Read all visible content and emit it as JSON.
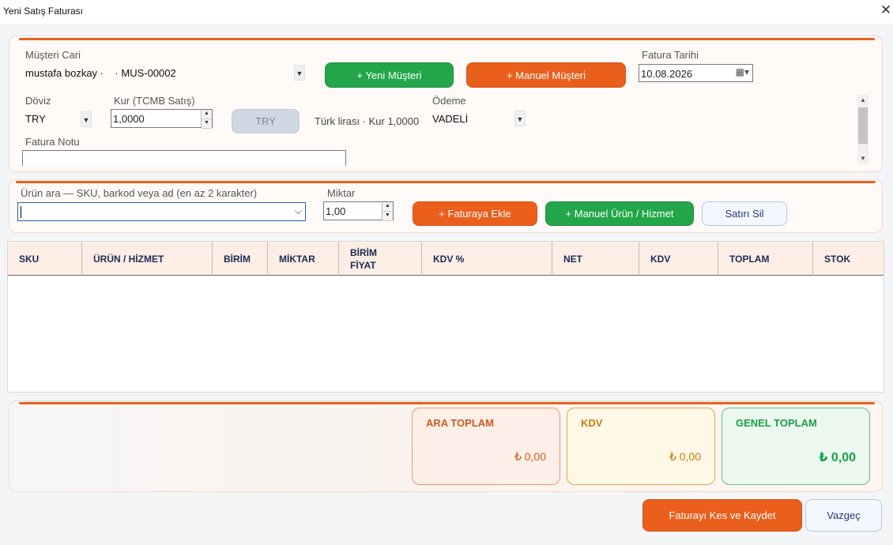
{
  "window": {
    "title": "Yeni Satış Faturası",
    "close_glyph": "✕"
  },
  "customer": {
    "label": "Müşteri Cari",
    "value": "mustafa bozkay ·    · MUS-00002",
    "new_button": "+ Yeni Müşteri",
    "manual_button": "+ Manuel Müşteri"
  },
  "invoice_date": {
    "label": "Fatura Tarihi",
    "value": "10.08.2026"
  },
  "currency": {
    "label": "Döviz",
    "value": "TRY"
  },
  "rate": {
    "label": "Kur (TCMB Satış)",
    "value": "1,0000",
    "button": "TRY",
    "info": "Türk lirası · Kur 1,0000"
  },
  "payment": {
    "label": "Ödeme",
    "value": "VADELİ"
  },
  "note": {
    "label": "Fatura Notu",
    "value": ""
  },
  "product_search": {
    "label": "Ürün ara — SKU, barkod veya ad (en az 2 karakter)",
    "value": ""
  },
  "quantity": {
    "label": "Miktar",
    "value": "1,00"
  },
  "actions": {
    "add_to_invoice": "+ Faturaya Ekle",
    "manual_product": "+ Manuel Ürün / Hizmet",
    "delete_row": "Satırı Sil"
  },
  "table": {
    "columns": [
      "SKU",
      "ÜRÜN / HİZMET",
      "BİRİM",
      "MİKTAR",
      "BİRİM\nFİYAT",
      "KDV %",
      "NET",
      "KDV",
      "TOPLAM",
      "STOK"
    ],
    "rows": []
  },
  "totals": {
    "subtotal": {
      "label": "ARA TOPLAM",
      "value": "₺ 0,00"
    },
    "vat": {
      "label": "KDV",
      "value": "₺ 0,00"
    },
    "grand": {
      "label": "GENEL TOPLAM",
      "value": "₺ 0,00"
    }
  },
  "footer": {
    "save_button": "Faturayı Kes ve Kaydet",
    "cancel_button": "Vazgeç"
  },
  "colors": {
    "accent": "#e8621c",
    "green": "#23a649",
    "navy": "#1c2a55"
  }
}
